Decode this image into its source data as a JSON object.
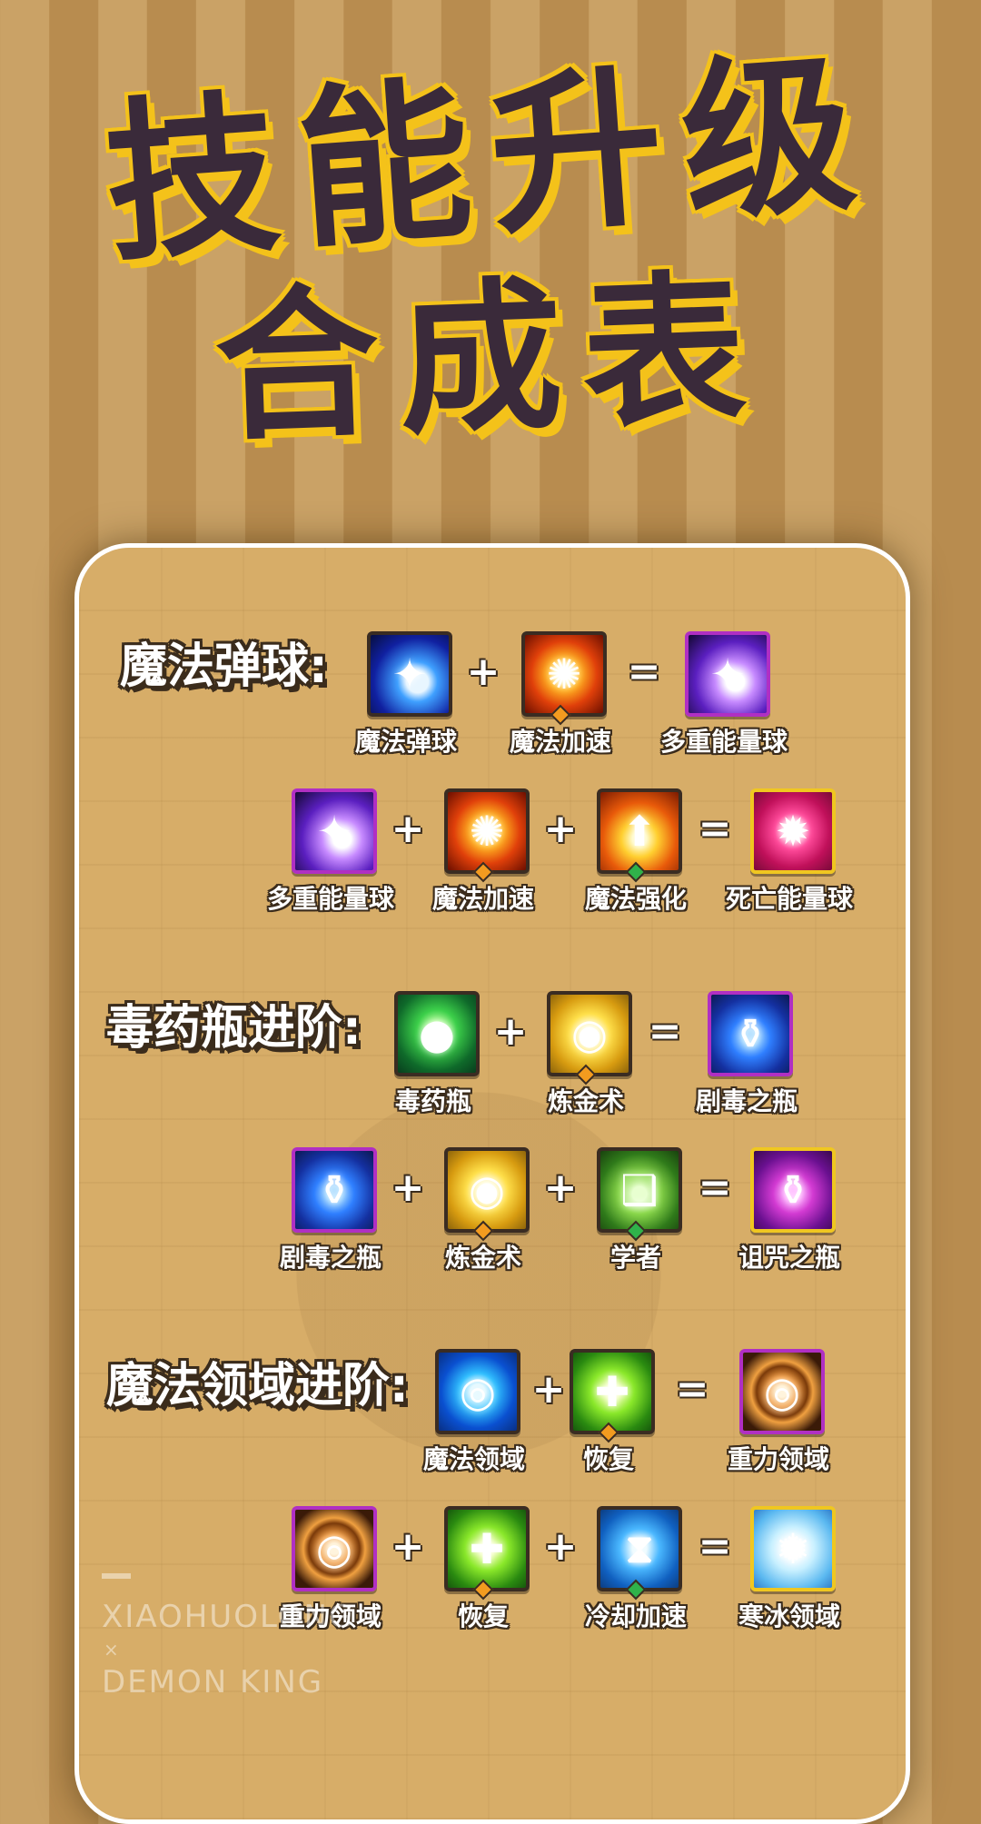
{
  "title": {
    "line1": "技能升级",
    "line2": "合成表"
  },
  "sections": [
    {
      "label": "魔法弹球:",
      "recipes": [
        {
          "items": [
            {
              "name": "魔法弹球",
              "icon": "blue-fireball-icon"
            },
            {
              "name": "魔法加速",
              "icon": "orange-swirl-icon"
            },
            {
              "name": "多重能量球",
              "icon": "purple-fireball-icon"
            }
          ],
          "ops": [
            "+",
            "="
          ]
        },
        {
          "items": [
            {
              "name": "多重能量球",
              "icon": "purple-fireball-icon"
            },
            {
              "name": "魔法加速",
              "icon": "orange-swirl-icon"
            },
            {
              "name": "魔法强化",
              "icon": "power-arrow-icon"
            },
            {
              "name": "死亡能量球",
              "icon": "pink-orb-icon"
            }
          ],
          "ops": [
            "+",
            "+",
            "="
          ]
        }
      ]
    },
    {
      "label": "毒药瓶进阶:",
      "recipes": [
        {
          "items": [
            {
              "name": "毒药瓶",
              "icon": "green-poison-icon"
            },
            {
              "name": "炼金术",
              "icon": "gold-coins-icon"
            },
            {
              "name": "剧毒之瓶",
              "icon": "blue-bottle-icon"
            }
          ],
          "ops": [
            "+",
            "="
          ]
        },
        {
          "items": [
            {
              "name": "剧毒之瓶",
              "icon": "blue-bottle-icon"
            },
            {
              "name": "炼金术",
              "icon": "gold-coins-icon"
            },
            {
              "name": "学者",
              "icon": "book-icon"
            },
            {
              "name": "诅咒之瓶",
              "icon": "magenta-bottle-icon"
            }
          ],
          "ops": [
            "+",
            "+",
            "="
          ]
        }
      ]
    },
    {
      "label": "魔法领域进阶:",
      "recipes": [
        {
          "items": [
            {
              "name": "魔法领域",
              "icon": "blue-ring-icon"
            },
            {
              "name": "恢复",
              "icon": "green-cross-icon"
            },
            {
              "name": "重力领域",
              "icon": "gravity-ring-icon"
            }
          ],
          "ops": [
            "+",
            "="
          ]
        },
        {
          "items": [
            {
              "name": "重力领域",
              "icon": "gravity-ring-icon"
            },
            {
              "name": "恢复",
              "icon": "green-cross-icon"
            },
            {
              "name": "冷却加速",
              "icon": "hourglass-icon"
            },
            {
              "name": "寒冰领域",
              "icon": "snowflake-icon"
            }
          ],
          "ops": [
            "+",
            "+",
            "="
          ]
        }
      ]
    }
  ],
  "watermark": {
    "line1": "XIAOHUOLONG",
    "line2": "×",
    "line3": "DEMON KING"
  }
}
